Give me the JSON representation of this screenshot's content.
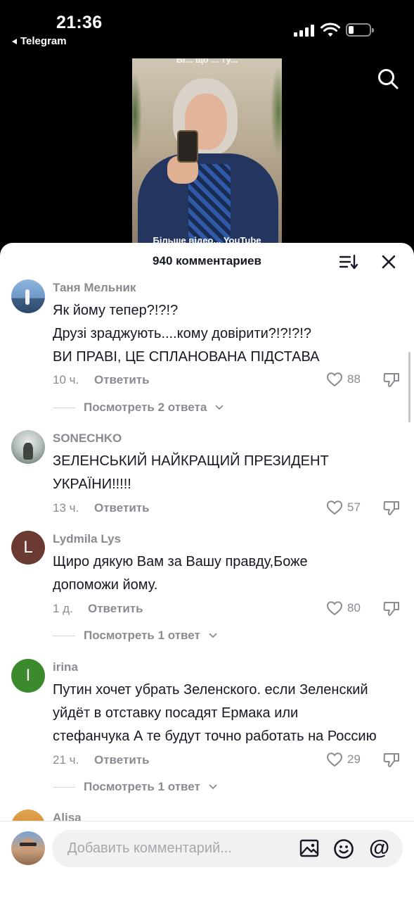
{
  "status_bar": {
    "time": "21:36",
    "back_app": "Telegram"
  },
  "video": {
    "top_caption": "Бі... що ... ту...",
    "caption": "Більше відео... YouTube"
  },
  "sheet": {
    "title": "940 комментариев"
  },
  "comments": [
    {
      "username": "Таня Мельник",
      "lines": [
        "Як йому тепер?!?!?",
        "Друзі зраджують....кому довірити?!?!?!?",
        "ВИ ПРАВІ, ЦЕ СПЛАНОВАНА ПІДСТАВА"
      ],
      "age": "10 ч.",
      "reply_label": "Ответить",
      "likes": "88",
      "view_replies": "Посмотреть 2 ответа"
    },
    {
      "username": "SONECHKO",
      "lines": [
        "ЗЕЛЕНСЬКИЙ НАЙКРАЩИЙ ПРЕЗИДЕНТ",
        "УКРАЇНИ!!!!!"
      ],
      "age": "13 ч.",
      "reply_label": "Ответить",
      "likes": "57"
    },
    {
      "username": "Lydmila Lys",
      "avatar_letter": "L",
      "avatar_color": "#6b3a32",
      "lines": [
        "Щиро дякую Вам за Вашу правду,Боже",
        "допоможи йому."
      ],
      "age": "1 д.",
      "reply_label": "Ответить",
      "likes": "80",
      "view_replies": "Посмотреть 1 ответ"
    },
    {
      "username": "irina",
      "avatar_letter": "I",
      "avatar_color": "#3b8a2e",
      "lines": [
        "Путин хочет убрать Зеленского. если Зеленский",
        "уйдёт в отставку посадят Ермака или",
        "стефанчука А те будут точно работать на Россию"
      ],
      "age": "21 ч.",
      "reply_label": "Ответить",
      "likes": "29",
      "view_replies": "Посмотреть 1 ответ"
    },
    {
      "username": "Alisa"
    }
  ],
  "input": {
    "placeholder": "Добавить комментарий..."
  },
  "colors": {
    "muted": "#8a8b91",
    "text": "#161823",
    "input_bg": "#f1f1f2"
  }
}
